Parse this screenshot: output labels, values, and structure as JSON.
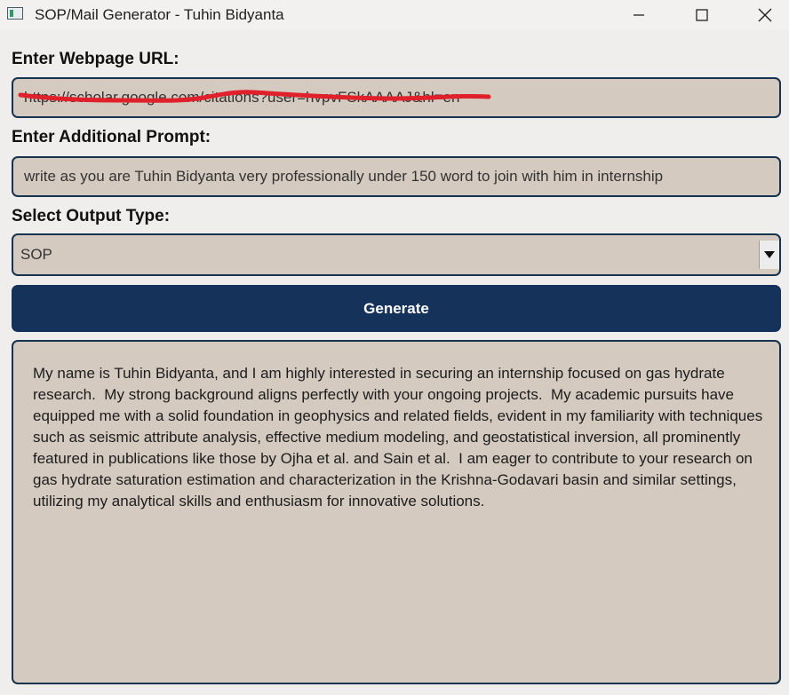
{
  "window": {
    "title": "SOP/Mail Generator - Tuhin Bidyanta",
    "icon": "app-window-icon",
    "controls": [
      "minimize-icon",
      "maximize-icon",
      "close-icon"
    ]
  },
  "url_section": {
    "label": "Enter Webpage URL:",
    "value": "https://scholar.google.com/citations?user=hvpvFSkAAAAJ&hl=en",
    "redaction_color": "#e0202a"
  },
  "prompt_section": {
    "label": "Enter Additional Prompt:",
    "value": "write as you are Tuhin Bidyanta very professionally under 150 word to join with him in internship"
  },
  "output_type_section": {
    "label": "Select Output Type:",
    "selected": "SOP",
    "arrow_icon": "dropdown-arrow-icon"
  },
  "generate_button": {
    "label": "Generate",
    "color": "#15325a"
  },
  "output": {
    "text": "My name is Tuhin Bidyanta, and I am highly interested in securing an internship focused on gas hydrate research.  My strong background aligns perfectly with your ongoing projects.  My academic pursuits have equipped me with a solid foundation in geophysics and related fields, evident in my familiarity with techniques such as seismic attribute analysis, effective medium modeling, and geostatistical inversion, all prominently featured in publications like those by Ojha et al. and Sain et al.  I am eager to contribute to your research on gas hydrate saturation estimation and characterization in the Krishna-Godavari basin and similar settings, utilizing my analytical skills and enthusiasm for innovative solutions."
  },
  "colors": {
    "field_bg": "#d5cac0",
    "border": "#17334f",
    "window_bg": "#f0eeec"
  }
}
